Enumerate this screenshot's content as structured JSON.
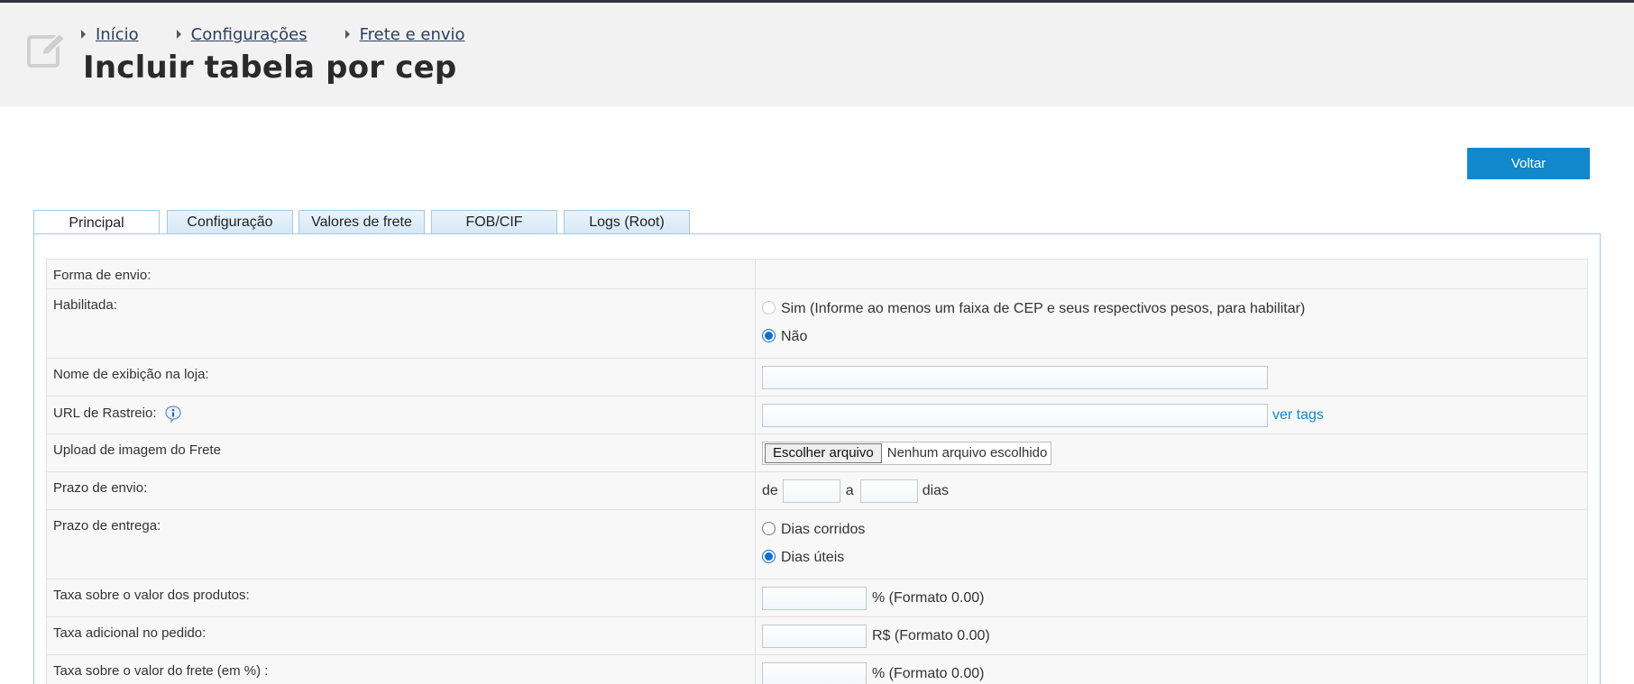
{
  "breadcrumb": [
    {
      "label": "Início"
    },
    {
      "label": "Configurações"
    },
    {
      "label": "Frete e envio"
    }
  ],
  "page": {
    "title": "Incluir tabela por cep"
  },
  "actions": {
    "back_label": "Voltar"
  },
  "tabs": [
    {
      "label": "Principal",
      "active": true
    },
    {
      "label": "Configuração",
      "active": false
    },
    {
      "label": "Valores de frete",
      "active": false
    },
    {
      "label": "FOB/CIF",
      "active": false
    },
    {
      "label": "Logs (Root)",
      "active": false
    }
  ],
  "form": {
    "forma_envio": {
      "label": "Forma de envio:"
    },
    "habilitada": {
      "label": "Habilitada:",
      "options": [
        {
          "label": "Sim (Informe ao menos um faixa de CEP e seus respectivos pesos, para habilitar)",
          "checked": false,
          "disabled": true
        },
        {
          "label": "Não",
          "checked": true,
          "disabled": false
        }
      ]
    },
    "nome_exibicao": {
      "label": "Nome de exibição na loja:",
      "value": ""
    },
    "url_rastreio": {
      "label": "URL de Rastreio:",
      "value": "",
      "link": "ver tags"
    },
    "upload_imagem": {
      "label": "Upload de imagem do Frete",
      "button": "Escolher arquivo",
      "status": "Nenhum arquivo escolhido"
    },
    "prazo_envio": {
      "label": "Prazo de envio:",
      "prefix": "de",
      "middle": "a",
      "suffix": "dias",
      "from": "",
      "to": ""
    },
    "prazo_entrega": {
      "label": "Prazo de entrega:",
      "options": [
        {
          "label": "Dias corridos",
          "checked": false
        },
        {
          "label": "Dias úteis",
          "checked": true
        }
      ]
    },
    "taxa_produtos": {
      "label": "Taxa sobre o valor dos produtos:",
      "value": "",
      "suffix": "% (Formato 0.00)"
    },
    "taxa_adicional": {
      "label": "Taxa adicional no pedido:",
      "value": "",
      "suffix": "R$ (Formato 0.00)"
    },
    "taxa_frete": {
      "label": "Taxa sobre o valor do frete (em %) :",
      "value": "",
      "suffix": "% (Formato 0.00)"
    }
  },
  "colors": {
    "accent": "#1188cc",
    "radio": "#0b6fd6",
    "tab_border": "#a6c9e2"
  }
}
